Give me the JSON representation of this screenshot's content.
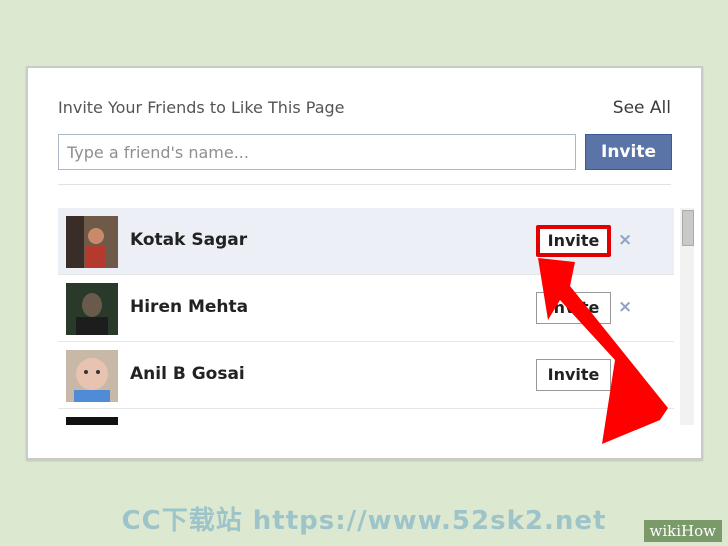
{
  "dialog": {
    "title": "Invite Your Friends to Like This Page",
    "see_all": "See All",
    "search_placeholder": "Type a friend's name...",
    "invite_button": "Invite"
  },
  "friends": [
    {
      "name": "Kotak Sagar",
      "invite_label": "Invite",
      "dismiss": "×"
    },
    {
      "name": "Hiren Mehta",
      "invite_label": "Invite",
      "dismiss": "×"
    },
    {
      "name": "Anil B Gosai",
      "invite_label": "Invite",
      "dismiss": "×"
    }
  ],
  "watermark": "CC下载站 https://www.52sk2.net",
  "brand": "wikiHow",
  "colors": {
    "accent": "#5b74a8",
    "highlight_row": "#eceff5",
    "callout_red": "#ff0000"
  }
}
